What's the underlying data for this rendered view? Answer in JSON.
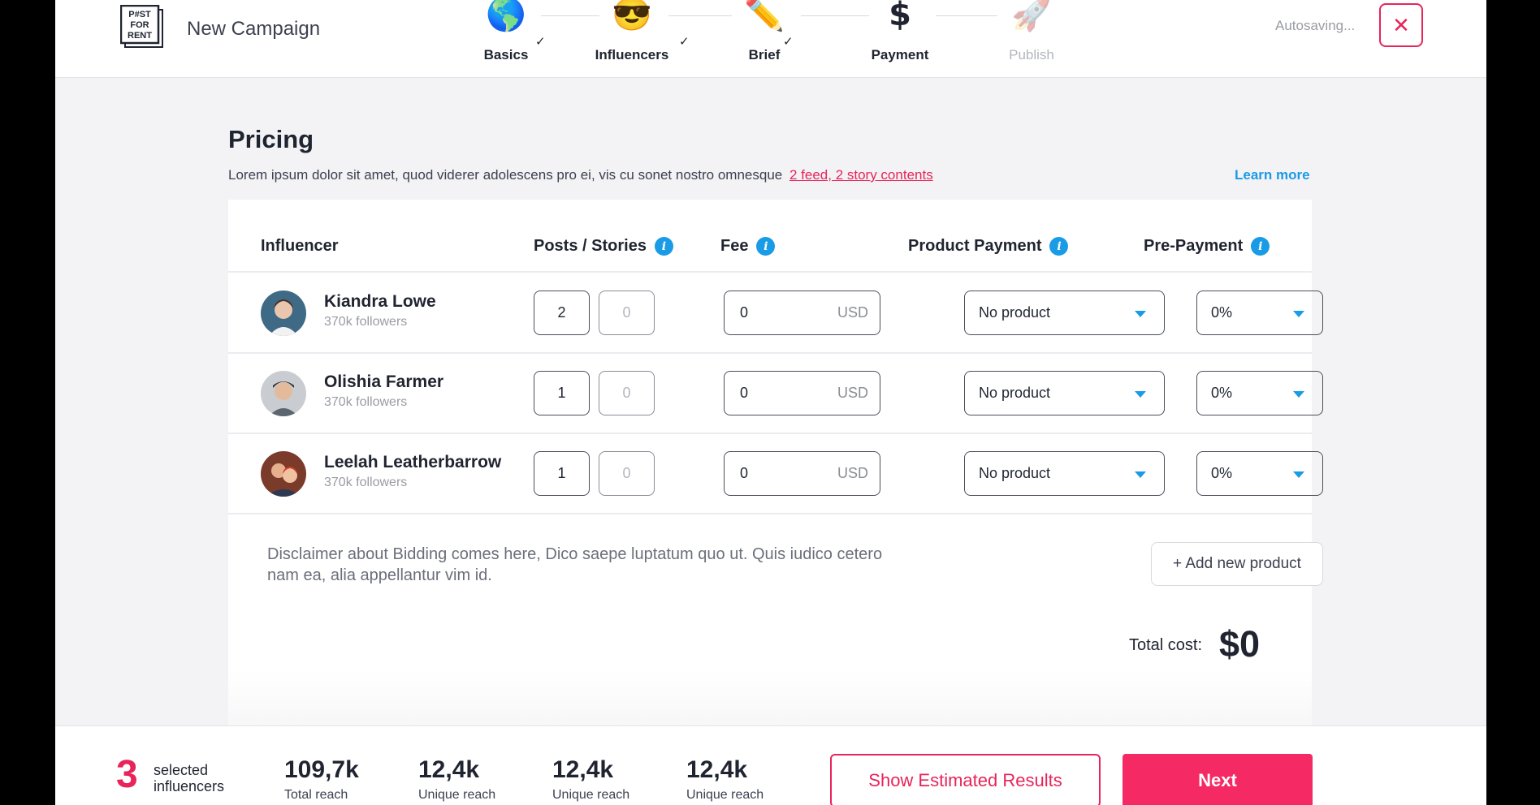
{
  "header": {
    "logo_text": "P#ST FOR RENT",
    "title": "New Campaign",
    "autosave": "Autosaving...",
    "close_icon": "close-icon"
  },
  "steps": [
    {
      "label": "Basics",
      "icon": "globe-icon",
      "emoji": "🌎",
      "done": true,
      "active": false
    },
    {
      "label": "Influencers",
      "icon": "sunglasses-face-icon",
      "emoji": "😎",
      "done": true,
      "active": false
    },
    {
      "label": "Brief",
      "icon": "pencil-icon",
      "emoji": "✏️",
      "done": true,
      "active": false
    },
    {
      "label": "Payment",
      "icon": "dollar-icon",
      "emoji": "$",
      "done": false,
      "active": true
    },
    {
      "label": "Publish",
      "icon": "rocket-icon",
      "emoji": "🚀",
      "done": false,
      "active": false
    }
  ],
  "pricing": {
    "title": "Pricing",
    "description": "Lorem ipsum dolor sit amet, quod viderer adolescens pro ei, vis cu sonet nostro omnesque",
    "description_link": "2 feed, 2 story contents",
    "learn_more": "Learn more",
    "columns": {
      "influencer": "Influencer",
      "posts_stories": "Posts / Stories",
      "fee": "Fee",
      "product_payment": "Product Payment",
      "pre_payment": "Pre-Payment"
    },
    "rows": [
      {
        "name": "Kiandra Lowe",
        "followers": "370k followers",
        "posts": "2",
        "stories": "0",
        "fee": "0",
        "currency": "USD",
        "product": "No product",
        "prepayment": "0%"
      },
      {
        "name": "Olishia Farmer",
        "followers": "370k followers",
        "posts": "1",
        "stories": "0",
        "fee": "0",
        "currency": "USD",
        "product": "No product",
        "prepayment": "0%"
      },
      {
        "name": "Leelah Leatherbarrow",
        "followers": "370k followers",
        "posts": "1",
        "stories": "0",
        "fee": "0",
        "currency": "USD",
        "product": "No product",
        "prepayment": "0%"
      }
    ],
    "disclaimer": "Disclaimer about Bidding comes here, Dico saepe luptatum quo ut. Quis iudico cetero nam ea, alia appellantur vim id.",
    "add_product": "+ Add new product",
    "total_label": "Total cost:",
    "total_value": "$0"
  },
  "footer": {
    "selected_count": "3",
    "selected_label": "selected influencers",
    "stats": [
      {
        "value": "109,7k",
        "label": "Total reach"
      },
      {
        "value": "12,4k",
        "label": "Unique reach"
      },
      {
        "value": "12,4k",
        "label": "Unique reach"
      },
      {
        "value": "12,4k",
        "label": "Unique reach"
      }
    ],
    "show_results": "Show Estimated Results",
    "next": "Next"
  },
  "colors": {
    "accent": "#e8245a",
    "primary_button": "#f52a64",
    "info_blue": "#1a9be6"
  }
}
